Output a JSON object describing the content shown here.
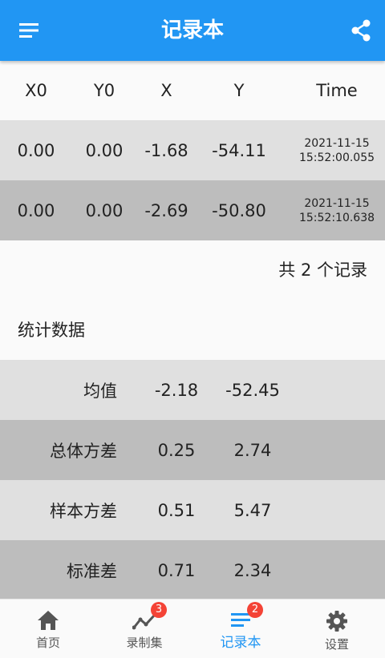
{
  "appbar": {
    "title": "记录本"
  },
  "table": {
    "headers": [
      "X0",
      "Y0",
      "X",
      "Y",
      "Time"
    ],
    "rows": [
      {
        "x0": "0.00",
        "y0": "0.00",
        "x": "-1.68",
        "y": "-54.11",
        "date": "2021-11-15",
        "time": "15:52:00.055"
      },
      {
        "x0": "0.00",
        "y0": "0.00",
        "x": "-2.69",
        "y": "-50.80",
        "date": "2021-11-15",
        "time": "15:52:10.638"
      }
    ],
    "count_text": "共 2 个记录"
  },
  "stats": {
    "title": "统计数据",
    "rows": [
      {
        "label": "均值",
        "x": "-2.18",
        "y": "-52.45"
      },
      {
        "label": "总体方差",
        "x": "0.25",
        "y": "2.74"
      },
      {
        "label": "样本方差",
        "x": "0.51",
        "y": "5.47"
      },
      {
        "label": "标准差",
        "x": "0.71",
        "y": "2.34"
      }
    ]
  },
  "nav": {
    "items": [
      {
        "label": "首页",
        "icon": "home-icon"
      },
      {
        "label": "录制集",
        "icon": "trend-icon",
        "badge": "3"
      },
      {
        "label": "记录本",
        "icon": "notes-icon",
        "badge": "2",
        "active": true
      },
      {
        "label": "设置",
        "icon": "gear-icon"
      }
    ]
  },
  "colors": {
    "primary": "#2196f3",
    "badge": "#f44336",
    "row_light": "#e0e0e0",
    "row_dark": "#bdbdbd"
  }
}
